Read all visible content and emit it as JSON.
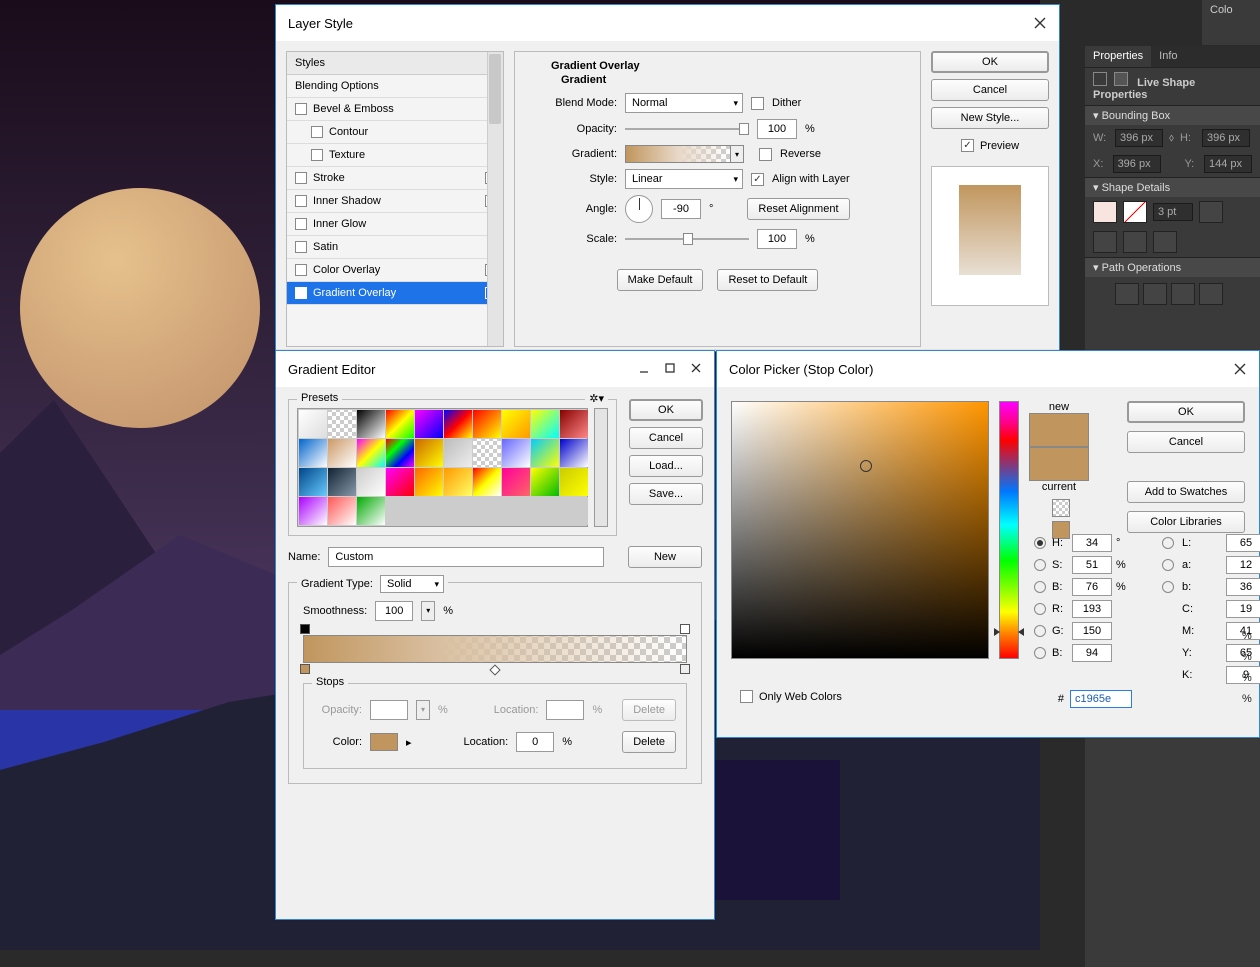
{
  "topcolor_label": "Colo",
  "right_panel": {
    "tabs": [
      "Properties",
      "Info"
    ],
    "active_tab": 0,
    "title": "Live Shape Properties",
    "sections": {
      "bounding": {
        "head": "Bounding Box",
        "w_label": "W:",
        "w": "396 px",
        "h_label": "H:",
        "h": "396 px",
        "x_label": "X:",
        "x": "396 px",
        "y_label": "Y:",
        "y": "144 px"
      },
      "shape": {
        "head": "Shape Details",
        "stroke": "3 pt"
      },
      "path": {
        "head": "Path Operations"
      }
    }
  },
  "layer_style": {
    "title": "Layer Style",
    "list_head": "Styles",
    "items": [
      {
        "label": "Blending Options"
      },
      {
        "label": "Bevel & Emboss",
        "cb": true,
        "plus": false
      },
      {
        "label": "Contour",
        "cb": true,
        "sub": true
      },
      {
        "label": "Texture",
        "cb": true,
        "sub": true
      },
      {
        "label": "Stroke",
        "cb": true,
        "plus": true
      },
      {
        "label": "Inner Shadow",
        "cb": true,
        "plus": true
      },
      {
        "label": "Inner Glow",
        "cb": true
      },
      {
        "label": "Satin",
        "cb": true
      },
      {
        "label": "Color Overlay",
        "cb": true,
        "plus": true
      },
      {
        "label": "Gradient Overlay",
        "cb": true,
        "plus": true,
        "selected": true,
        "checked": true
      }
    ],
    "section_title": "Gradient Overlay",
    "sub_title": "Gradient",
    "blend_mode_label": "Blend Mode:",
    "blend_mode_value": "Normal",
    "dither_label": "Dither",
    "opacity_label": "Opacity:",
    "opacity_value": "100",
    "gradient_label": "Gradient:",
    "reverse_label": "Reverse",
    "style_label": "Style:",
    "style_value": "Linear",
    "align_label": "Align with Layer",
    "angle_label": "Angle:",
    "angle_value": "-90",
    "scale_label": "Scale:",
    "scale_value": "100",
    "reset_align": "Reset Alignment",
    "make_default": "Make Default",
    "reset_default": "Reset to Default",
    "btns": {
      "ok": "OK",
      "cancel": "Cancel",
      "new_style": "New Style...",
      "preview": "Preview"
    }
  },
  "gradient_editor": {
    "title": "Gradient Editor",
    "presets_label": "Presets",
    "btns": {
      "ok": "OK",
      "cancel": "Cancel",
      "load": "Load...",
      "save": "Save...",
      "new": "New"
    },
    "name_label": "Name:",
    "name_value": "Custom",
    "type_label": "Gradient Type:",
    "type_value": "Solid",
    "smooth_label": "Smoothness:",
    "smooth_value": "100",
    "stops_label": "Stops",
    "opacity_label": "Opacity:",
    "location_label": "Location:",
    "color_label": "Color:",
    "delete": "Delete",
    "location_value": "0"
  },
  "color_picker": {
    "title": "Color Picker (Stop Color)",
    "new_label": "new",
    "current_label": "current",
    "btns": {
      "ok": "OK",
      "cancel": "Cancel",
      "add": "Add to Swatches",
      "lib": "Color Libraries"
    },
    "webonly": "Only Web Colors",
    "vals": {
      "H": "34",
      "S": "51",
      "B": "76",
      "R": "193",
      "G": "150",
      "Bb": "94",
      "L": "65",
      "a": "12",
      "b": "36",
      "C": "19",
      "M": "41",
      "Y": "65",
      "K": "9",
      "hex": "c1965e"
    },
    "new_color": "#c1965e",
    "old_color": "#c1965e"
  },
  "preset_gradients": [
    "linear-gradient(135deg,#fff,#ddd)",
    "repeating-conic-gradient(#ccc 0 25%,#fff 0 50%) 0/8px 8px",
    "linear-gradient(135deg,#000,#fff)",
    "linear-gradient(135deg,#f00,#ff0,#0f0)",
    "linear-gradient(135deg,#f0f,#00f)",
    "linear-gradient(135deg,#00f,#f00,#ff0)",
    "linear-gradient(135deg,#f00,#ff0)",
    "linear-gradient(135deg,#ff0,#f90)",
    "linear-gradient(135deg,#ff0,#0ff)",
    "linear-gradient(135deg,#800,#f88)",
    "linear-gradient(135deg,#06c,#fff)",
    "linear-gradient(135deg,#c96,#fff)",
    "linear-gradient(135deg,#f0f,#ff0,#0ff)",
    "linear-gradient(135deg,#f00,#0f0,#00f,#f0f)",
    "linear-gradient(135deg,#c60,#ff0)",
    "linear-gradient(135deg,#bbb,#eee)",
    "repeating-conic-gradient(#ccc 0 25%,#fff 0 50%) 0/8px 8px",
    "linear-gradient(135deg,#66f,#fff)",
    "linear-gradient(135deg,#0cf,#ff0)",
    "linear-gradient(135deg,#00c,#fff)",
    "linear-gradient(135deg,#048,#6cf)",
    "linear-gradient(135deg,#123,#89a)",
    "linear-gradient(135deg,#ccc,#fff)",
    "linear-gradient(135deg,#f0f,#f00)",
    "linear-gradient(135deg,#f60,#ff0)",
    "linear-gradient(135deg,#f90,#ff6)",
    "linear-gradient(135deg,#f00,#ff0,#fff)",
    "linear-gradient(135deg,#f09,#f66)",
    "linear-gradient(135deg,#ff0,#0b0)",
    "linear-gradient(135deg,#cc0,#ff0)",
    "linear-gradient(135deg,#a0f,#fff)",
    "linear-gradient(135deg,#f55,#fff)",
    "linear-gradient(135deg,#0a0,#fff)"
  ]
}
